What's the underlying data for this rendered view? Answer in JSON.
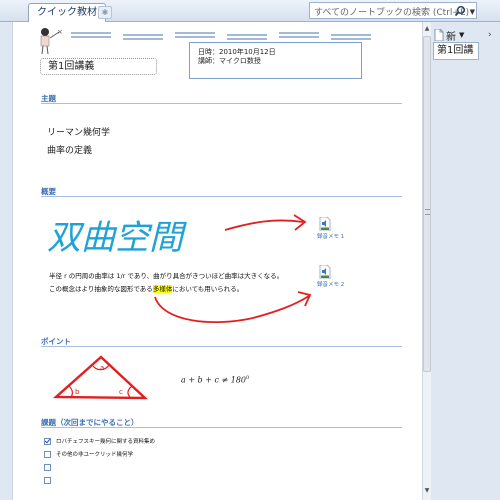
{
  "top_bar": {
    "notebook_tab": "クイック教材",
    "search_placeholder": "すべてのノートブックの検索 (Ctrl+E)"
  },
  "page_list": {
    "new_button_label": "新",
    "pages": [
      "第1回講"
    ]
  },
  "page": {
    "title": "第1回講義",
    "date_line": "日時：2010年10月12日",
    "lecturer_line": "講師：マイクロ数授",
    "sections": [
      {
        "heading": "主題",
        "items": [
          "リーマン幾何学",
          "曲率の定義"
        ]
      },
      {
        "heading": "概要",
        "handwriting": "双曲空間",
        "paragraph_line1": "半径 r の円周の曲率は 1/r であり、曲がり具合がきついほど曲率は大きくなる。",
        "paragraph_line2_before": "この概念はより抽象的な図形である",
        "paragraph_line2_highlight": "多様体",
        "paragraph_line2_after": "においても用いられる。",
        "memo_links": [
          "録音メモ 1",
          "録音メモ 2"
        ]
      },
      {
        "heading": "ポイント",
        "formula": "a + b + c ≠ 180",
        "formula_sup": "0",
        "triangle_labels": [
          "a",
          "b",
          "c"
        ]
      },
      {
        "heading": "課題（次回までにやること）",
        "tasks": [
          {
            "label": "ロバチェフスキー幾何に関する資料集め",
            "checked": true
          },
          {
            "label": "その他の非ユークリッド幾何学",
            "checked": false
          },
          {
            "label": "",
            "checked": false
          },
          {
            "label": "",
            "checked": false
          }
        ]
      }
    ]
  },
  "colors": {
    "heading_blue": "#3d6fb8",
    "handwriting_blue": "#1fa3d6",
    "ink_red": "#e02020",
    "highlight": "#ffff00"
  },
  "icons": [
    "search-icon",
    "new-page-icon",
    "audio-memo-icon",
    "notebook-tab-add-icon"
  ]
}
